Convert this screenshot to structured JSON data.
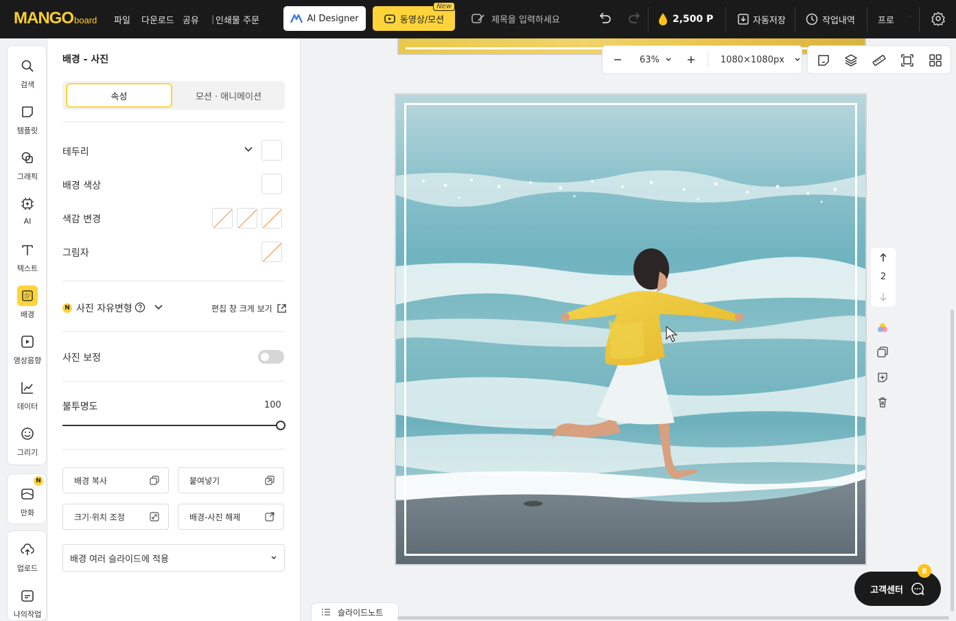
{
  "app": {
    "logo_main": "MANGO",
    "logo_sub": "board"
  },
  "topbar": {
    "menu": [
      "파일",
      "다운로드",
      "공유",
      "인쇄물 주문"
    ],
    "ai_designer_label": "AI Designer",
    "video_motion_label": "동영상/모션",
    "new_tag": "New",
    "title_placeholder": "제목을 입력하세요",
    "points": "2,500 P",
    "autosave_label": "자동저장",
    "history_label": "작업내역",
    "pro_label": "프로"
  },
  "rail": {
    "items": [
      "검색",
      "템플릿",
      "그래픽",
      "AI",
      "텍스트",
      "배경",
      "영상음향",
      "데이터",
      "그리기"
    ],
    "comic": "만화",
    "comic_badge": "N",
    "upload": "업로드",
    "my_work": "나의작업"
  },
  "panel": {
    "title": "배경 - 사진",
    "tabs": [
      "속성",
      "모션 · 애니메이션"
    ],
    "border_label": "테두리",
    "bg_color_label": "배경 색상",
    "tint_label": "색감 변경",
    "shadow_label": "그림자",
    "freeform_badge": "N",
    "freeform_label": "사진 자유변형",
    "expand_label": "편집 창 크게 보기",
    "correction_label": "사진 보정",
    "opacity_label": "불투명도",
    "opacity_value": "100",
    "opacity_level": 1.0,
    "buttons": [
      "배경 복사",
      "붙여넣기",
      "크기·위치 조정",
      "배경-사진 해제"
    ],
    "apply_select": "배경 여러 슬라이드에 적용"
  },
  "canvas": {
    "zoom": "63%",
    "size": "1080×1080px",
    "page_number": "2",
    "help_label": "고객센터",
    "help_badge": "8",
    "slide_note": "슬라이드노트"
  },
  "colors": {
    "accent": "#ffd43b",
    "topbar": "#1a1a1a",
    "panel": "#ffffff",
    "canvas_bg": "#f1f2f4"
  }
}
